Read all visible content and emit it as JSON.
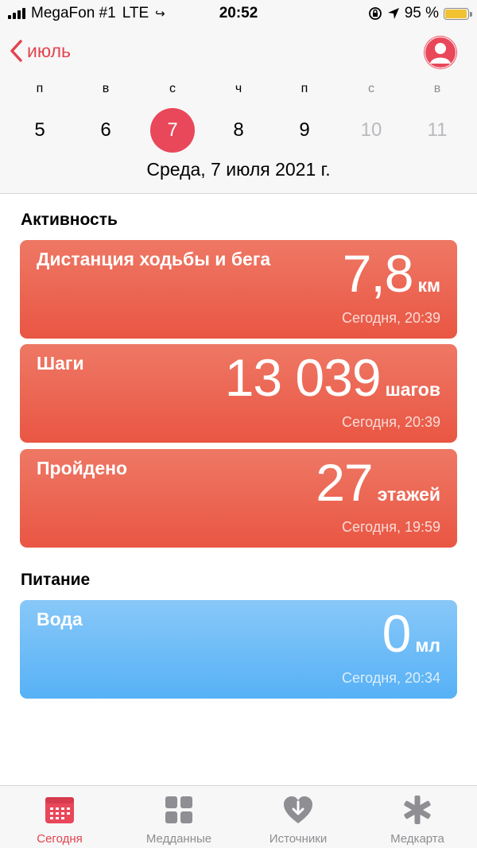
{
  "status_bar": {
    "carrier": "MegaFon #1",
    "network": "LTE",
    "time": "20:52",
    "battery": "95 %",
    "battery_level": 0.95
  },
  "nav": {
    "back_label": "июль"
  },
  "week": {
    "weekdays": [
      "п",
      "в",
      "с",
      "ч",
      "п",
      "с",
      "в"
    ],
    "days": [
      "5",
      "6",
      "7",
      "8",
      "9",
      "10",
      "11"
    ],
    "selected_index": 2,
    "date_title": "Среда, 7 июля 2021 г."
  },
  "sections": {
    "activity": "Активность",
    "nutrition": "Питание"
  },
  "cards": {
    "distance": {
      "title": "Дистанция ходьбы и бега",
      "value": "7,8",
      "unit": "км",
      "time": "Сегодня, 20:39"
    },
    "steps": {
      "title": "Шаги",
      "value": "13 039",
      "unit": "шагов",
      "time": "Сегодня, 20:39"
    },
    "floors": {
      "title": "Пройдено",
      "value": "27",
      "unit": "этажей",
      "time": "Сегодня, 19:59"
    },
    "water": {
      "title": "Вода",
      "value": "0",
      "unit": "мл",
      "time": "Сегодня, 20:34"
    }
  },
  "tabs": {
    "today": "Сегодня",
    "health_data": "Медданные",
    "sources": "Источники",
    "medical_id": "Медкарта"
  },
  "colors": {
    "accent": "#e9475a",
    "activity_card": "#eb5f4b",
    "nutrition_card": "#5fb5f7",
    "inactive": "#8e8e93"
  }
}
